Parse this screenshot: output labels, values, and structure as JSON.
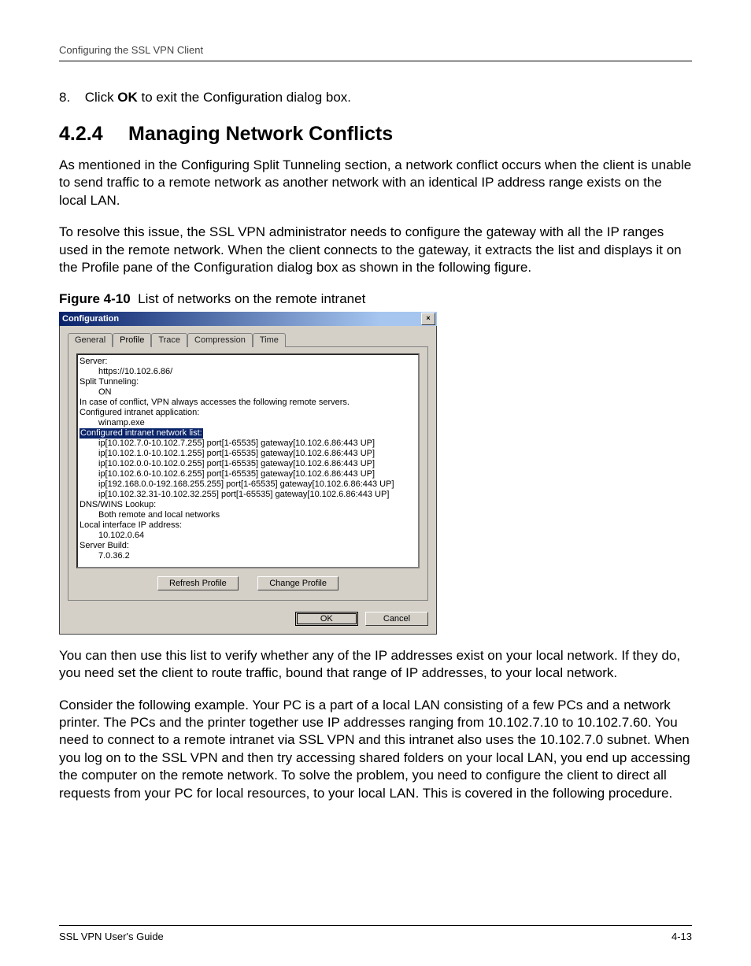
{
  "running_header": "Configuring the SSL VPN Client",
  "step": {
    "num": "8.",
    "text_before": "Click ",
    "bold": "OK",
    "text_after": " to exit the Configuration dialog box."
  },
  "heading": {
    "num": "4.2.4",
    "title": "Managing Network Conflicts"
  },
  "para1": "As mentioned in the Configuring Split Tunneling section, a network conflict occurs when the client is unable to send traffic to a remote network as another network with an identical IP address range exists on the local LAN.",
  "para2": "To resolve this issue, the SSL VPN administrator needs to configure the gateway with all the IP ranges used in the remote network. When the client connects to the gateway, it extracts the list and displays it on the Profile pane of the Configuration dialog box as shown in the following figure.",
  "figure": {
    "label": "Figure 4-10",
    "caption": "List of networks on the remote intranet"
  },
  "dlg": {
    "title": "Configuration",
    "close": "×",
    "tabs": {
      "general": "General",
      "profile": "Profile",
      "trace": "Trace",
      "compression": "Compression",
      "time": "Time"
    },
    "list": {
      "l1": "Server:",
      "l1v": "https://10.102.6.86/",
      "l2": "Split Tunneling:",
      "l2v": "ON",
      "l3": "In case of conflict, VPN always accesses the following remote servers.",
      "l4": "Configured intranet application:",
      "l4v": "winamp.exe",
      "sel": "Configured intranet network list:",
      "n1": "ip[10.102.7.0-10.102.7.255] port[1-65535] gateway[10.102.6.86:443 UP]",
      "n2": "ip[10.102.1.0-10.102.1.255] port[1-65535] gateway[10.102.6.86:443 UP]",
      "n3": "ip[10.102.0.0-10.102.0.255] port[1-65535] gateway[10.102.6.86:443 UP]",
      "n4": "ip[10.102.6.0-10.102.6.255] port[1-65535] gateway[10.102.6.86:443 UP]",
      "n5": "ip[192.168.0.0-192.168.255.255] port[1-65535] gateway[10.102.6.86:443 UP]",
      "n6": "ip[10.102.32.31-10.102.32.255] port[1-65535] gateway[10.102.6.86:443 UP]",
      "l5": "DNS/WINS Lookup:",
      "l5v": "Both remote and local networks",
      "l6": "Local interface IP address:",
      "l6v": "10.102.0.64",
      "l7": "Server Build:",
      "l7v": "7.0.36.2"
    },
    "buttons": {
      "refresh": "Refresh Profile",
      "change": "Change Profile",
      "ok": "OK",
      "cancel": "Cancel"
    }
  },
  "para3": "You can then use this list to verify whether any of the IP addresses exist on your local network. If they do, you need set the client to route traffic, bound that range of IP addresses, to your local network.",
  "para4": "Consider the following example. Your PC is a part of a local LAN consisting of a few PCs and a network printer. The PCs and the printer together use IP addresses ranging from 10.102.7.10 to 10.102.7.60. You need to connect to a remote intranet via SSL VPN and this intranet also uses the 10.102.7.0 subnet. When you log on to the SSL VPN and then try accessing shared folders on your local LAN, you end up accessing the computer on the remote network. To solve the problem, you need to configure the client to direct all requests from your PC for local resources, to your local LAN. This is covered in the following procedure.",
  "footer": {
    "left": "SSL VPN User's Guide",
    "right": "4-13"
  }
}
